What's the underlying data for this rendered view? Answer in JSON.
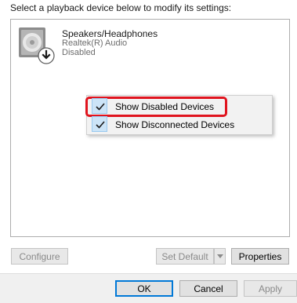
{
  "instruction": "Select a playback device below to modify its settings:",
  "device": {
    "name": "Speakers/Headphones",
    "driver": "Realtek(R) Audio",
    "status": "Disabled",
    "icon": "speaker-icon"
  },
  "context_menu": {
    "items": [
      {
        "label": "Show Disabled Devices",
        "checked": true,
        "highlighted": true
      },
      {
        "label": "Show Disconnected Devices",
        "checked": true,
        "highlighted": false
      }
    ]
  },
  "buttons": {
    "configure": "Configure",
    "set_default": "Set Default",
    "properties": "Properties",
    "ok": "OK",
    "cancel": "Cancel",
    "apply": "Apply"
  },
  "colors": {
    "highlight_border": "#e0141e",
    "check_bg": "#cce4f7",
    "accent": "#0078d7"
  }
}
